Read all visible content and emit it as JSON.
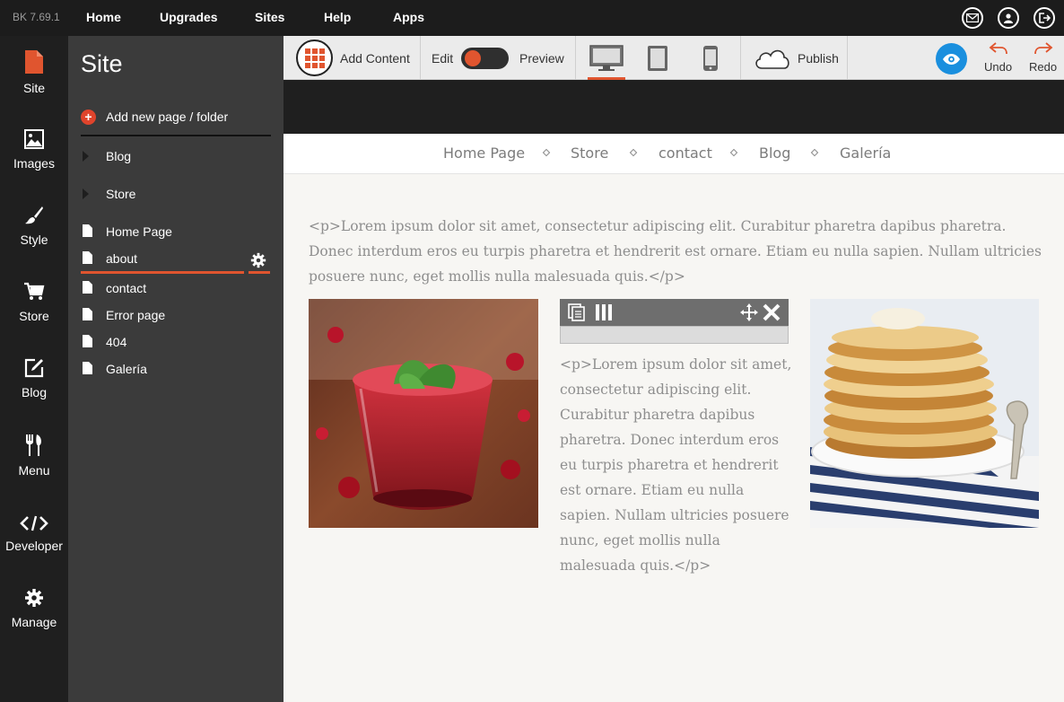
{
  "top_bar": {
    "version": "BK 7.69.1",
    "nav": [
      "Home",
      "Upgrades",
      "Sites",
      "Help",
      "Apps"
    ],
    "icons": [
      "mail-icon",
      "account-icon",
      "logout-icon"
    ]
  },
  "rail": {
    "items": [
      {
        "label": "Site",
        "icon": "site-page-icon"
      },
      {
        "label": "Images",
        "icon": "image-icon"
      },
      {
        "label": "Style",
        "icon": "brush-icon"
      },
      {
        "label": "Store",
        "icon": "cart-icon"
      },
      {
        "label": "Blog",
        "icon": "edit-icon"
      },
      {
        "label": "Menu",
        "icon": "fork-knife-icon"
      },
      {
        "label": "Developer",
        "icon": "code-icon"
      },
      {
        "label": "Manage",
        "icon": "gear-icon"
      }
    ],
    "active": "Site"
  },
  "panel": {
    "title": "Site",
    "add_new": "Add new page / folder",
    "tree": [
      {
        "label": "Blog",
        "type": "folder"
      },
      {
        "label": "Store",
        "type": "folder"
      },
      {
        "label": "Home Page",
        "type": "page"
      },
      {
        "label": "about",
        "type": "page",
        "selected": true
      },
      {
        "label": "contact",
        "type": "page"
      },
      {
        "label": "Error page",
        "type": "page"
      },
      {
        "label": "404",
        "type": "page"
      },
      {
        "label": "Galería",
        "type": "page"
      }
    ]
  },
  "toolbar": {
    "add_content": "Add Content",
    "edit": "Edit",
    "preview": "Preview",
    "publish": "Publish",
    "undo": "Undo",
    "redo": "Redo"
  },
  "site": {
    "nav": [
      "Home Page",
      "Store",
      "contact",
      "Blog",
      "Galería"
    ],
    "paragraph": "<p>Lorem ipsum dolor sit amet, consectetur adipiscing elit. Curabitur pharetra dapibus pharetra. Donec interdum eros eu turpis pharetra et hendrerit est ornare. Etiam eu nulla sapien. Nullam ultricies posuere nunc, eget mollis nulla malesuada quis.</p>",
    "column_paragraph": "<p>Lorem ipsum dolor sit amet, consectetur adipiscing elit. Curabitur pharetra dapibus pharetra. Donec interdum eros eu turpis pharetra et hendrerit est ornare. Etiam eu nulla sapien. Nullam ultricies posuere nunc, eget mollis nulla malesuada quis.</p>"
  },
  "colors": {
    "accent": "#e0552f",
    "eye_button": "#1a8fde",
    "top_bar": "#1c1c1c",
    "panel": "#3b3b3b"
  }
}
